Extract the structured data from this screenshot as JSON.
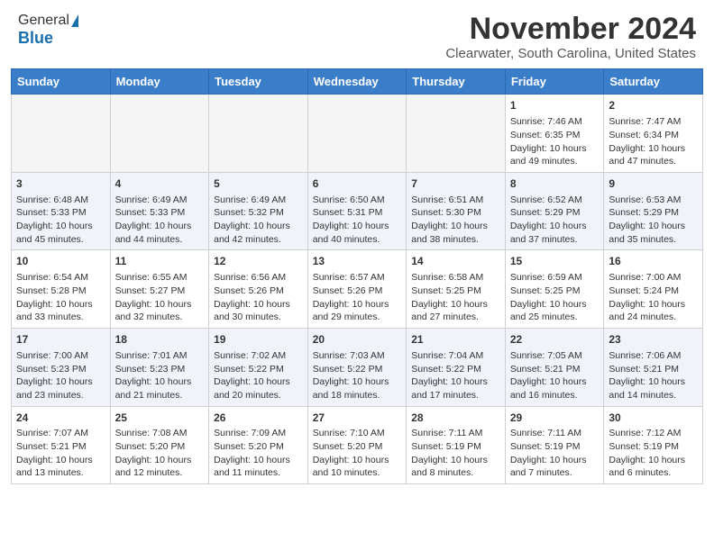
{
  "header": {
    "logo_general": "General",
    "logo_blue": "Blue",
    "month_title": "November 2024",
    "location": "Clearwater, South Carolina, United States"
  },
  "calendar": {
    "headers": [
      "Sunday",
      "Monday",
      "Tuesday",
      "Wednesday",
      "Thursday",
      "Friday",
      "Saturday"
    ],
    "rows": [
      [
        {
          "day": "",
          "empty": true
        },
        {
          "day": "",
          "empty": true
        },
        {
          "day": "",
          "empty": true
        },
        {
          "day": "",
          "empty": true
        },
        {
          "day": "",
          "empty": true
        },
        {
          "day": "1",
          "sunrise": "Sunrise: 7:46 AM",
          "sunset": "Sunset: 6:35 PM",
          "daylight": "Daylight: 10 hours and 49 minutes."
        },
        {
          "day": "2",
          "sunrise": "Sunrise: 7:47 AM",
          "sunset": "Sunset: 6:34 PM",
          "daylight": "Daylight: 10 hours and 47 minutes."
        }
      ],
      [
        {
          "day": "3",
          "sunrise": "Sunrise: 6:48 AM",
          "sunset": "Sunset: 5:33 PM",
          "daylight": "Daylight: 10 hours and 45 minutes."
        },
        {
          "day": "4",
          "sunrise": "Sunrise: 6:49 AM",
          "sunset": "Sunset: 5:33 PM",
          "daylight": "Daylight: 10 hours and 44 minutes."
        },
        {
          "day": "5",
          "sunrise": "Sunrise: 6:49 AM",
          "sunset": "Sunset: 5:32 PM",
          "daylight": "Daylight: 10 hours and 42 minutes."
        },
        {
          "day": "6",
          "sunrise": "Sunrise: 6:50 AM",
          "sunset": "Sunset: 5:31 PM",
          "daylight": "Daylight: 10 hours and 40 minutes."
        },
        {
          "day": "7",
          "sunrise": "Sunrise: 6:51 AM",
          "sunset": "Sunset: 5:30 PM",
          "daylight": "Daylight: 10 hours and 38 minutes."
        },
        {
          "day": "8",
          "sunrise": "Sunrise: 6:52 AM",
          "sunset": "Sunset: 5:29 PM",
          "daylight": "Daylight: 10 hours and 37 minutes."
        },
        {
          "day": "9",
          "sunrise": "Sunrise: 6:53 AM",
          "sunset": "Sunset: 5:29 PM",
          "daylight": "Daylight: 10 hours and 35 minutes."
        }
      ],
      [
        {
          "day": "10",
          "sunrise": "Sunrise: 6:54 AM",
          "sunset": "Sunset: 5:28 PM",
          "daylight": "Daylight: 10 hours and 33 minutes."
        },
        {
          "day": "11",
          "sunrise": "Sunrise: 6:55 AM",
          "sunset": "Sunset: 5:27 PM",
          "daylight": "Daylight: 10 hours and 32 minutes."
        },
        {
          "day": "12",
          "sunrise": "Sunrise: 6:56 AM",
          "sunset": "Sunset: 5:26 PM",
          "daylight": "Daylight: 10 hours and 30 minutes."
        },
        {
          "day": "13",
          "sunrise": "Sunrise: 6:57 AM",
          "sunset": "Sunset: 5:26 PM",
          "daylight": "Daylight: 10 hours and 29 minutes."
        },
        {
          "day": "14",
          "sunrise": "Sunrise: 6:58 AM",
          "sunset": "Sunset: 5:25 PM",
          "daylight": "Daylight: 10 hours and 27 minutes."
        },
        {
          "day": "15",
          "sunrise": "Sunrise: 6:59 AM",
          "sunset": "Sunset: 5:25 PM",
          "daylight": "Daylight: 10 hours and 25 minutes."
        },
        {
          "day": "16",
          "sunrise": "Sunrise: 7:00 AM",
          "sunset": "Sunset: 5:24 PM",
          "daylight": "Daylight: 10 hours and 24 minutes."
        }
      ],
      [
        {
          "day": "17",
          "sunrise": "Sunrise: 7:00 AM",
          "sunset": "Sunset: 5:23 PM",
          "daylight": "Daylight: 10 hours and 23 minutes."
        },
        {
          "day": "18",
          "sunrise": "Sunrise: 7:01 AM",
          "sunset": "Sunset: 5:23 PM",
          "daylight": "Daylight: 10 hours and 21 minutes."
        },
        {
          "day": "19",
          "sunrise": "Sunrise: 7:02 AM",
          "sunset": "Sunset: 5:22 PM",
          "daylight": "Daylight: 10 hours and 20 minutes."
        },
        {
          "day": "20",
          "sunrise": "Sunrise: 7:03 AM",
          "sunset": "Sunset: 5:22 PM",
          "daylight": "Daylight: 10 hours and 18 minutes."
        },
        {
          "day": "21",
          "sunrise": "Sunrise: 7:04 AM",
          "sunset": "Sunset: 5:22 PM",
          "daylight": "Daylight: 10 hours and 17 minutes."
        },
        {
          "day": "22",
          "sunrise": "Sunrise: 7:05 AM",
          "sunset": "Sunset: 5:21 PM",
          "daylight": "Daylight: 10 hours and 16 minutes."
        },
        {
          "day": "23",
          "sunrise": "Sunrise: 7:06 AM",
          "sunset": "Sunset: 5:21 PM",
          "daylight": "Daylight: 10 hours and 14 minutes."
        }
      ],
      [
        {
          "day": "24",
          "sunrise": "Sunrise: 7:07 AM",
          "sunset": "Sunset: 5:21 PM",
          "daylight": "Daylight: 10 hours and 13 minutes."
        },
        {
          "day": "25",
          "sunrise": "Sunrise: 7:08 AM",
          "sunset": "Sunset: 5:20 PM",
          "daylight": "Daylight: 10 hours and 12 minutes."
        },
        {
          "day": "26",
          "sunrise": "Sunrise: 7:09 AM",
          "sunset": "Sunset: 5:20 PM",
          "daylight": "Daylight: 10 hours and 11 minutes."
        },
        {
          "day": "27",
          "sunrise": "Sunrise: 7:10 AM",
          "sunset": "Sunset: 5:20 PM",
          "daylight": "Daylight: 10 hours and 10 minutes."
        },
        {
          "day": "28",
          "sunrise": "Sunrise: 7:11 AM",
          "sunset": "Sunset: 5:19 PM",
          "daylight": "Daylight: 10 hours and 8 minutes."
        },
        {
          "day": "29",
          "sunrise": "Sunrise: 7:11 AM",
          "sunset": "Sunset: 5:19 PM",
          "daylight": "Daylight: 10 hours and 7 minutes."
        },
        {
          "day": "30",
          "sunrise": "Sunrise: 7:12 AM",
          "sunset": "Sunset: 5:19 PM",
          "daylight": "Daylight: 10 hours and 6 minutes."
        }
      ]
    ]
  }
}
